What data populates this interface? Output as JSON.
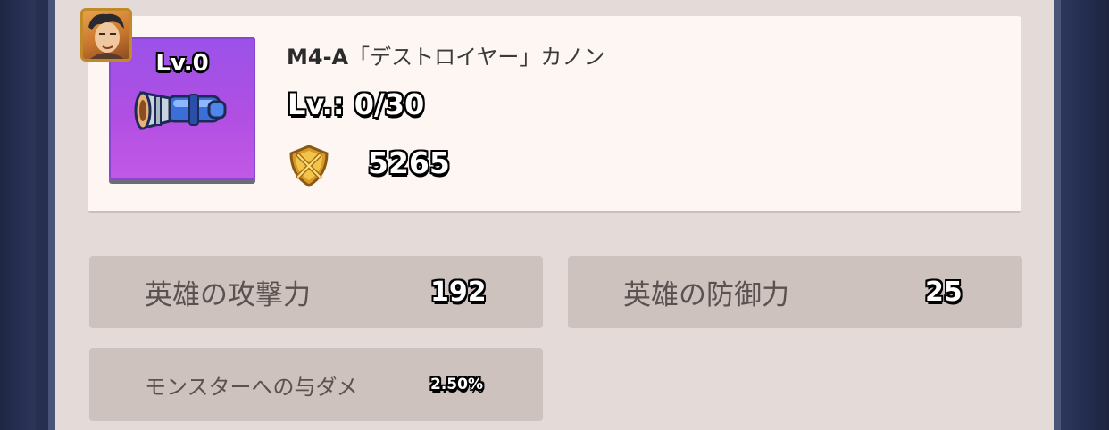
{
  "item": {
    "level_badge": "Lv.0",
    "model": "M4-A",
    "name": "「デストロイヤー」カノン",
    "level_label": "Lv.:",
    "level_value": "0/30",
    "power": "5265",
    "box_color": "#b14fe3"
  },
  "stats": [
    {
      "label": "英雄の攻撃力",
      "value": "192"
    },
    {
      "label": "英雄の防御力",
      "value": "25"
    },
    {
      "label": "モンスターへの与ダメ",
      "value": "2.50%"
    }
  ],
  "icons": {
    "hero_avatar": "hero-portrait-icon",
    "weapon": "cannon-icon",
    "power": "crossed-swords-shield-icon"
  }
}
